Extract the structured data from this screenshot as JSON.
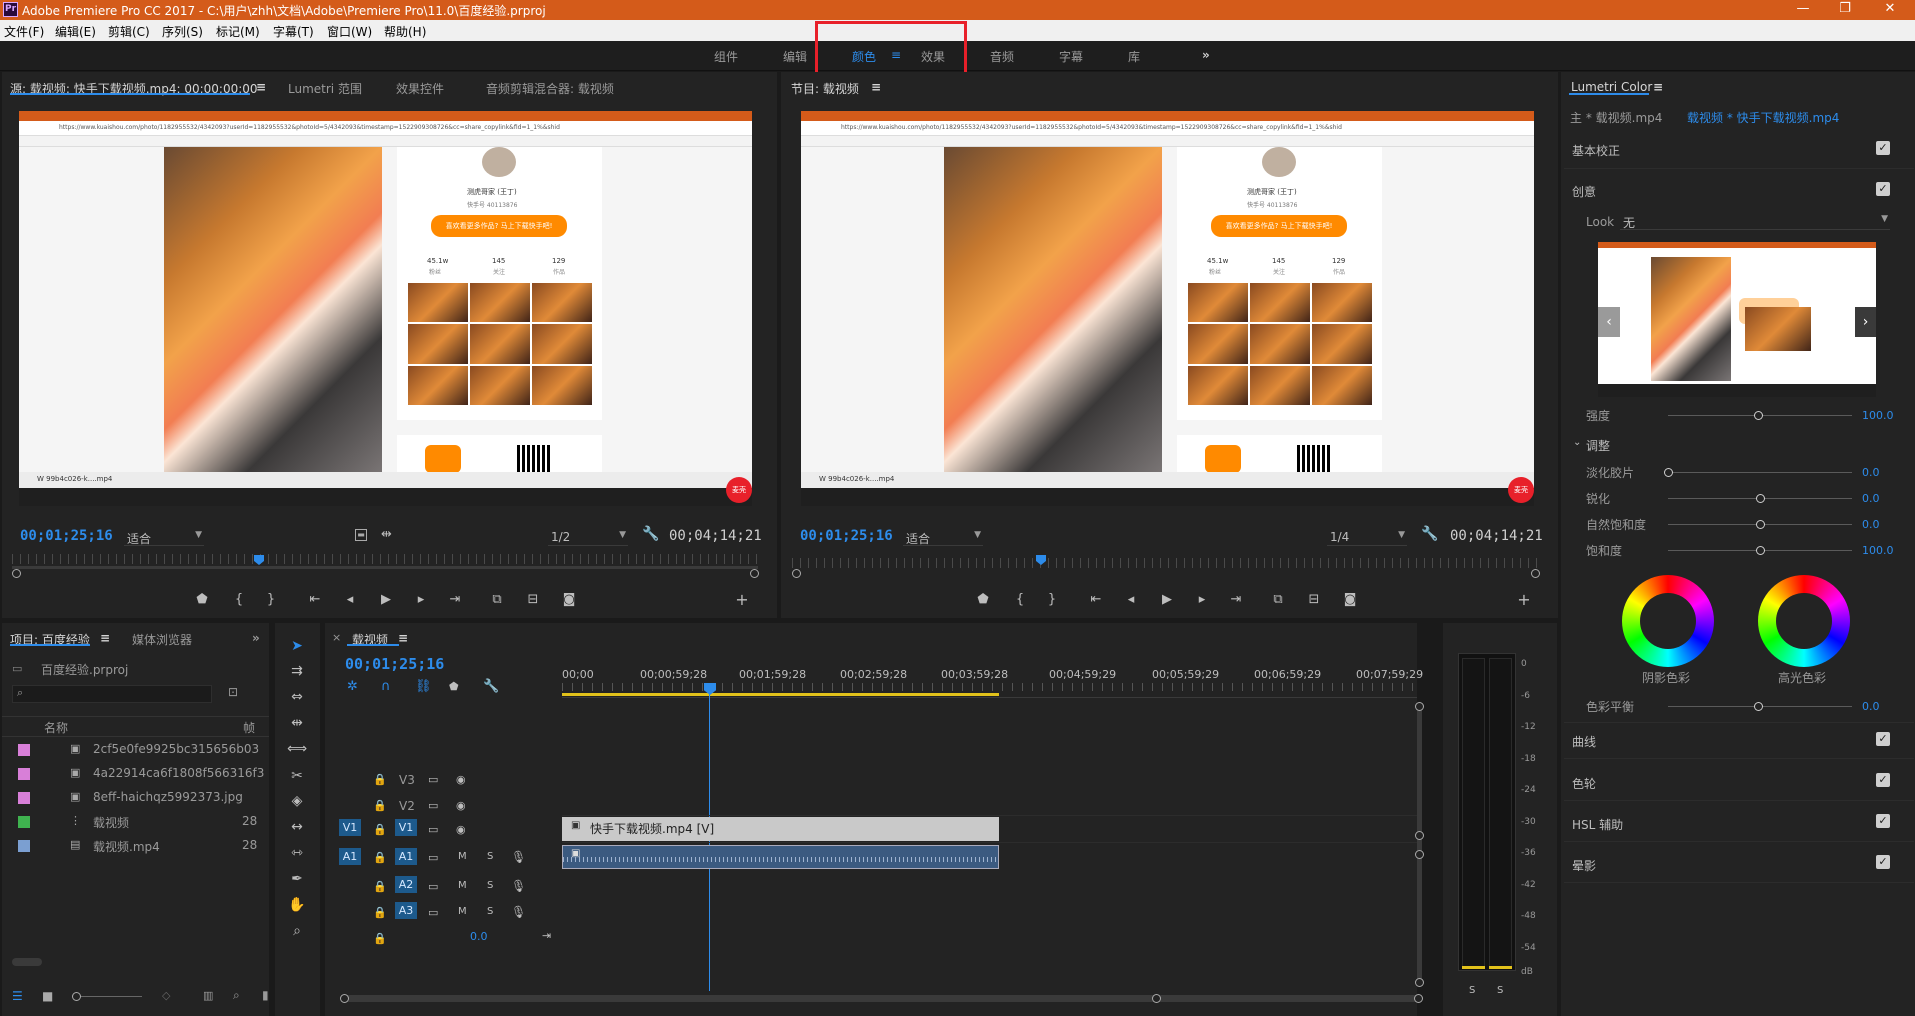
{
  "app": {
    "title": "Adobe Premiere Pro CC 2017 - C:\\用户\\zhh\\文档\\Adobe\\Premiere Pro\\11.0\\百度经验.prproj",
    "icon_text": "Pr"
  },
  "window_controls": [
    "—",
    "❐",
    "✕"
  ],
  "menu": [
    "文件(F)",
    "编辑(E)",
    "剪辑(C)",
    "序列(S)",
    "标记(M)",
    "字幕(T)",
    "窗口(W)",
    "帮助(H)"
  ],
  "workspaces": {
    "items": [
      "组件",
      "编辑",
      "颜色",
      "效果",
      "音频",
      "字幕",
      "库"
    ],
    "active": "颜色",
    "more": "»",
    "menu_icon": "≡"
  },
  "source_panel": {
    "tabs": [
      "源: 载视频: 快手下载视频.mp4: 00;00;00;00",
      "Lumetri 范围",
      "效果控件",
      "音频剪辑混合器: 载视频"
    ],
    "timecode": "00;01;25;16",
    "fit": "适合",
    "resolution": "1/2",
    "duration": "00;04;14;21"
  },
  "program_panel": {
    "tab": "节目: 载视频",
    "timecode": "00;01;25;16",
    "fit": "适合",
    "resolution": "1/4",
    "duration": "00;04;14;21"
  },
  "monitor_content": {
    "url": "https://www.kuaishou.com/photo/1182955532/4342093?userId=1182955532&photoId=5/4342093&timestamp=1522909308726&cc=share_copylink&fid=1_1%&shid",
    "profile_name": "测虎哥家 (王丁)",
    "profile_id": "快手号 40113876",
    "cta": "喜欢看更多作品? 马上下载快手吧!",
    "stats": [
      {
        "value": "45.1w",
        "label": "粉丝"
      },
      {
        "value": "145",
        "label": "关注"
      },
      {
        "value": "129",
        "label": "作品"
      }
    ],
    "taskbar_file": "W 99b4c026-k....mp4",
    "badge": "麦壳"
  },
  "project_panel": {
    "tabs": [
      "项目: 百度经验",
      "媒体浏览器"
    ],
    "file": "百度经验.prproj",
    "search_placeholder": "",
    "col_name": "名称",
    "col_rate": "帧",
    "items": [
      {
        "name": "2cf5e0fe9925bc315656b03",
        "color": "#d87fd8",
        "icon": "image",
        "rate": ""
      },
      {
        "name": "4a22914ca6f1808f566316f3",
        "color": "#d87fd8",
        "icon": "image",
        "rate": ""
      },
      {
        "name": "8eff-haichqz5992373.jpg",
        "color": "#d87fd8",
        "icon": "image",
        "rate": ""
      },
      {
        "name": "载视频",
        "color": "#3fb34f",
        "icon": "sequence",
        "rate": "28"
      },
      {
        "name": "载视频.mp4",
        "color": "#7b9fd1",
        "icon": "clip",
        "rate": "28"
      }
    ]
  },
  "timeline": {
    "tab": "载视频",
    "timecode": "00;01;25;16",
    "ruler": [
      "00;00",
      "00;00;59;28",
      "00;01;59;28",
      "00;02;59;28",
      "00;03;59;28",
      "00;04;59;29",
      "00;05;59;29",
      "00;06;59;29",
      "00;07;59;29"
    ],
    "video_tracks": [
      "V3",
      "V2",
      "V1"
    ],
    "audio_tracks": [
      "A1",
      "A2",
      "A3"
    ],
    "source_v": "V1",
    "source_a": "A1",
    "master_value": "0.0",
    "clip_label": "快手下载视频.mp4 [V]",
    "mute": "M",
    "solo": "S"
  },
  "meter": {
    "labels": [
      "0",
      "-6",
      "-12",
      "-18",
      "-24",
      "-30",
      "-36",
      "-42",
      "-48",
      "-54",
      "dB"
    ],
    "buttons": [
      "S",
      "S"
    ]
  },
  "lumetri": {
    "title": "Lumetri Color",
    "source": "主 * 载视频.mp4",
    "target": "载视频 * 快手下载视频.mp4",
    "sections": {
      "basic": "基本校正",
      "creative": "创意",
      "curves": "曲线",
      "wheels": "色轮",
      "hsl": "HSL 辅助",
      "vignette": "晕影"
    },
    "look_label": "Look",
    "look_value": "无",
    "intensity_label": "强度",
    "intensity_value": "100.0",
    "adjust_label": "调整",
    "sliders": [
      {
        "label": "淡化胶片",
        "value": "0.0",
        "pos": 0.0
      },
      {
        "label": "锐化",
        "value": "0.0",
        "pos": 0.5
      },
      {
        "label": "自然饱和度",
        "value": "0.0",
        "pos": 0.5
      },
      {
        "label": "饱和度",
        "value": "100.0",
        "pos": 0.5
      }
    ],
    "shadow_tint": "阴影色彩",
    "highlight_tint": "高光色彩",
    "balance_label": "色彩平衡",
    "balance_value": "0.0"
  },
  "colors": {
    "accent_blue": "#2d8ceb",
    "title_orange": "#d45b1a",
    "highlight_red": "#e8202a"
  }
}
